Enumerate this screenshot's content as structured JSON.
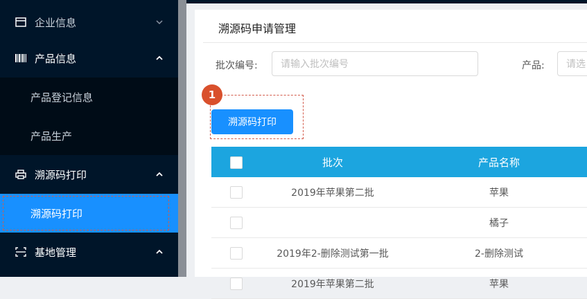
{
  "sidebar": {
    "groups": [
      {
        "label": "企业信息",
        "icon": "card-icon",
        "expanded": false
      },
      {
        "label": "产品信息",
        "icon": "barcode-icon",
        "expanded": true
      },
      {
        "label": "溯源码打印",
        "icon": "printer-icon",
        "expanded": true
      },
      {
        "label": "基地管理",
        "icon": "scan-icon",
        "expanded": true
      }
    ],
    "subitems": [
      {
        "label": "产品登记信息"
      },
      {
        "label": "产品生产"
      },
      {
        "label": "溯源码打印",
        "active": true
      }
    ]
  },
  "main": {
    "title": "溯源码申请管理",
    "filters": {
      "batch_label": "批次编号:",
      "batch_placeholder": "请输入批次编号",
      "product_label": "产品:",
      "product_placeholder": "请选"
    },
    "print_button": "溯源码打印",
    "step_badge": "1",
    "table": {
      "headers": [
        "批次",
        "产品名称"
      ],
      "rows": [
        {
          "batch": "2019年苹果第二批",
          "product": "苹果"
        },
        {
          "batch": "",
          "product": "橘子"
        },
        {
          "batch": "2019年2-删除测试第一批",
          "product": "2-删除测试"
        },
        {
          "batch": "2019年苹果第二批",
          "product": "苹果"
        }
      ]
    }
  },
  "colors": {
    "sidebar_bg": "#001529",
    "active_item": "#1890ff",
    "table_header": "#1ca5df",
    "badge": "#d9502c"
  }
}
